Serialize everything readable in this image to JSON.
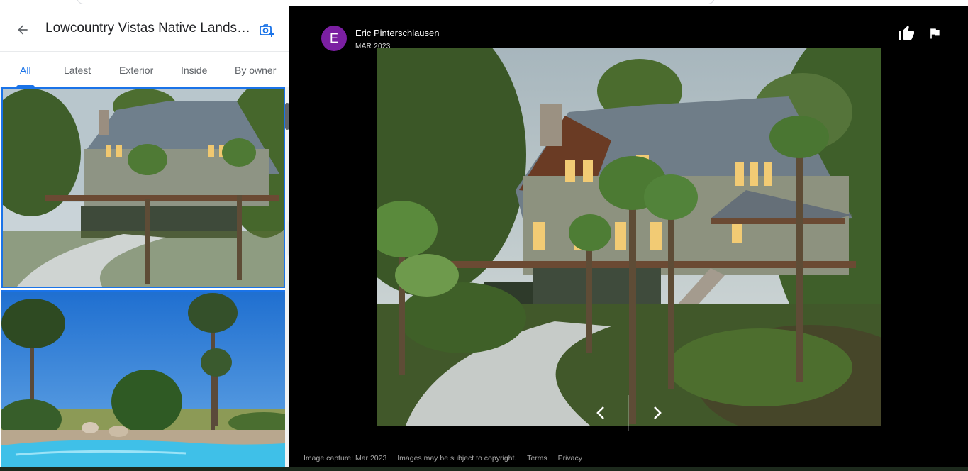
{
  "header": {
    "title": "Lowcountry Vistas Native Landsc..."
  },
  "tabs": [
    {
      "label": "All",
      "active": true
    },
    {
      "label": "Latest",
      "active": false
    },
    {
      "label": "Exterior",
      "active": false
    },
    {
      "label": "Inside",
      "active": false
    },
    {
      "label": "By owner",
      "active": false
    }
  ],
  "viewer": {
    "avatar_letter": "E",
    "avatar_color": "#7b1fa2",
    "author": "Eric Pinterschlausen",
    "date": "MAR 2023"
  },
  "footer": {
    "capture": "Image capture: Mar 2023",
    "copyright": "Images may be subject to copyright.",
    "terms": "Terms",
    "privacy": "Privacy"
  },
  "colors": {
    "accent": "#1a73e8",
    "viewer_bg": "#000000"
  },
  "icons": {
    "back": "arrow-left-icon",
    "add_photo": "add-photo-icon",
    "like": "thumbs-up-icon",
    "flag": "flag-icon",
    "collapse": "chevron-left-icon",
    "prev": "chevron-left-icon",
    "next": "chevron-right-icon"
  }
}
